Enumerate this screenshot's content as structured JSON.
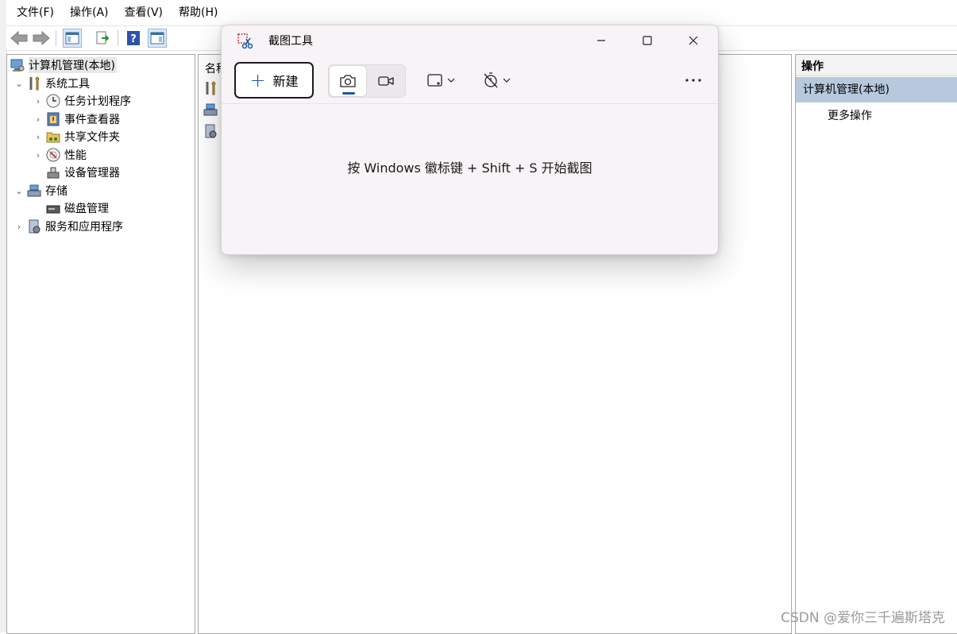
{
  "menubar": {
    "items": [
      "文件(F)",
      "操作(A)",
      "查看(V)",
      "帮助(H)"
    ]
  },
  "toolbar": {
    "icons": [
      "back-icon",
      "forward-icon",
      "show-hide-console-tree-icon",
      "export-list-icon",
      "help-icon",
      "show-hide-action-pane-icon"
    ]
  },
  "tree": {
    "root": "计算机管理(本地)",
    "system_tools": "系统工具",
    "task_scheduler": "任务计划程序",
    "event_viewer": "事件查看器",
    "shared_folders": "共享文件夹",
    "performance": "性能",
    "device_manager": "设备管理器",
    "storage": "存储",
    "disk_management": "磁盘管理",
    "services_apps": "服务和应用程序"
  },
  "center": {
    "column_name": "名称"
  },
  "actions": {
    "header": "操作",
    "selected": "计算机管理(本地)",
    "more": "更多操作"
  },
  "snip": {
    "title": "截图工具",
    "new_label": "新建",
    "hint": "按 Windows 徽标键 + Shift + S 开始截图"
  },
  "watermark": "CSDN @爱你三千遍斯塔克",
  "colors": {
    "accent": "#1a56b0",
    "action_selected": "#b7c9dd",
    "snip_bg": "#f8f3f6"
  }
}
